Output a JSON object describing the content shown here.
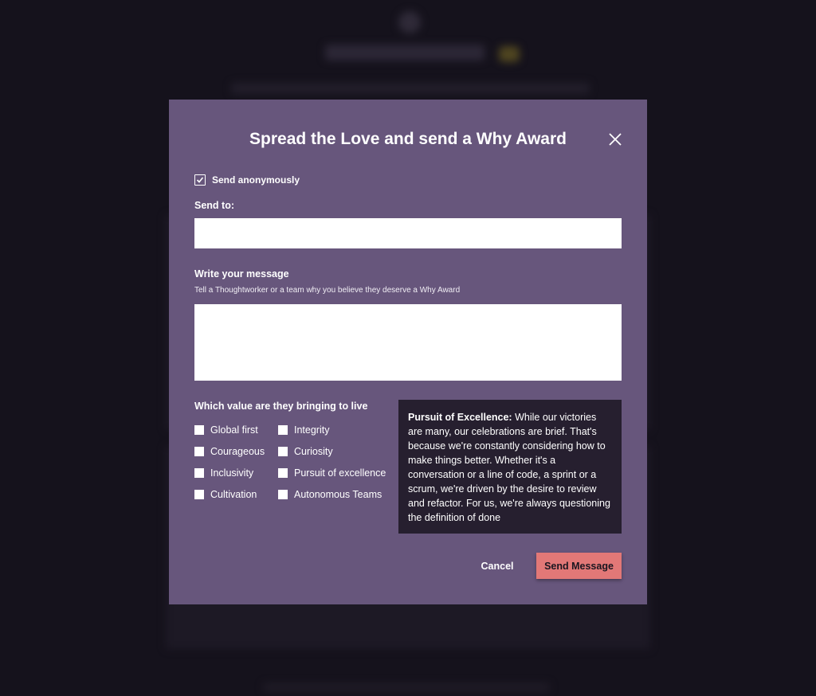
{
  "modal": {
    "title": "Spread the Love and send a Why Award",
    "anonymous_label": "Send anonymously",
    "anonymous_checked": true,
    "send_to_label": "Send to:",
    "send_to_value": "",
    "message_label": "Write your message",
    "message_hint": "Tell a Thoughtworker or a team why you believe they deserve a Why Award",
    "message_value": "",
    "values_label": "Which value are they bringing to live",
    "values": [
      {
        "label": "Global first",
        "checked": false
      },
      {
        "label": "Integrity",
        "checked": false
      },
      {
        "label": "Courageous",
        "checked": false
      },
      {
        "label": "Curiosity",
        "checked": false
      },
      {
        "label": "Inclusivity",
        "checked": false
      },
      {
        "label": "Pursuit of excellence",
        "checked": false
      },
      {
        "label": "Cultivation",
        "checked": false
      },
      {
        "label": "Autonomous Teams",
        "checked": false
      }
    ],
    "info": {
      "title": "Pursuit of Excellence:",
      "text": "While our victories are many, our celebrations are brief. That's because we're constantly considering how to make things better. Whether it's a conversation or a line of code, a sprint or a scrum, we're driven by the desire to review and refactor. For us, we're always questioning the definition of done"
    },
    "cancel_label": "Cancel",
    "send_label": "Send Message"
  },
  "colors": {
    "modal_bg": "#67567c",
    "info_bg": "#261f2f",
    "send_button": "#e27877",
    "page_bg": "#15121c"
  },
  "icons": [
    "close-icon",
    "checkmark-icon"
  ]
}
